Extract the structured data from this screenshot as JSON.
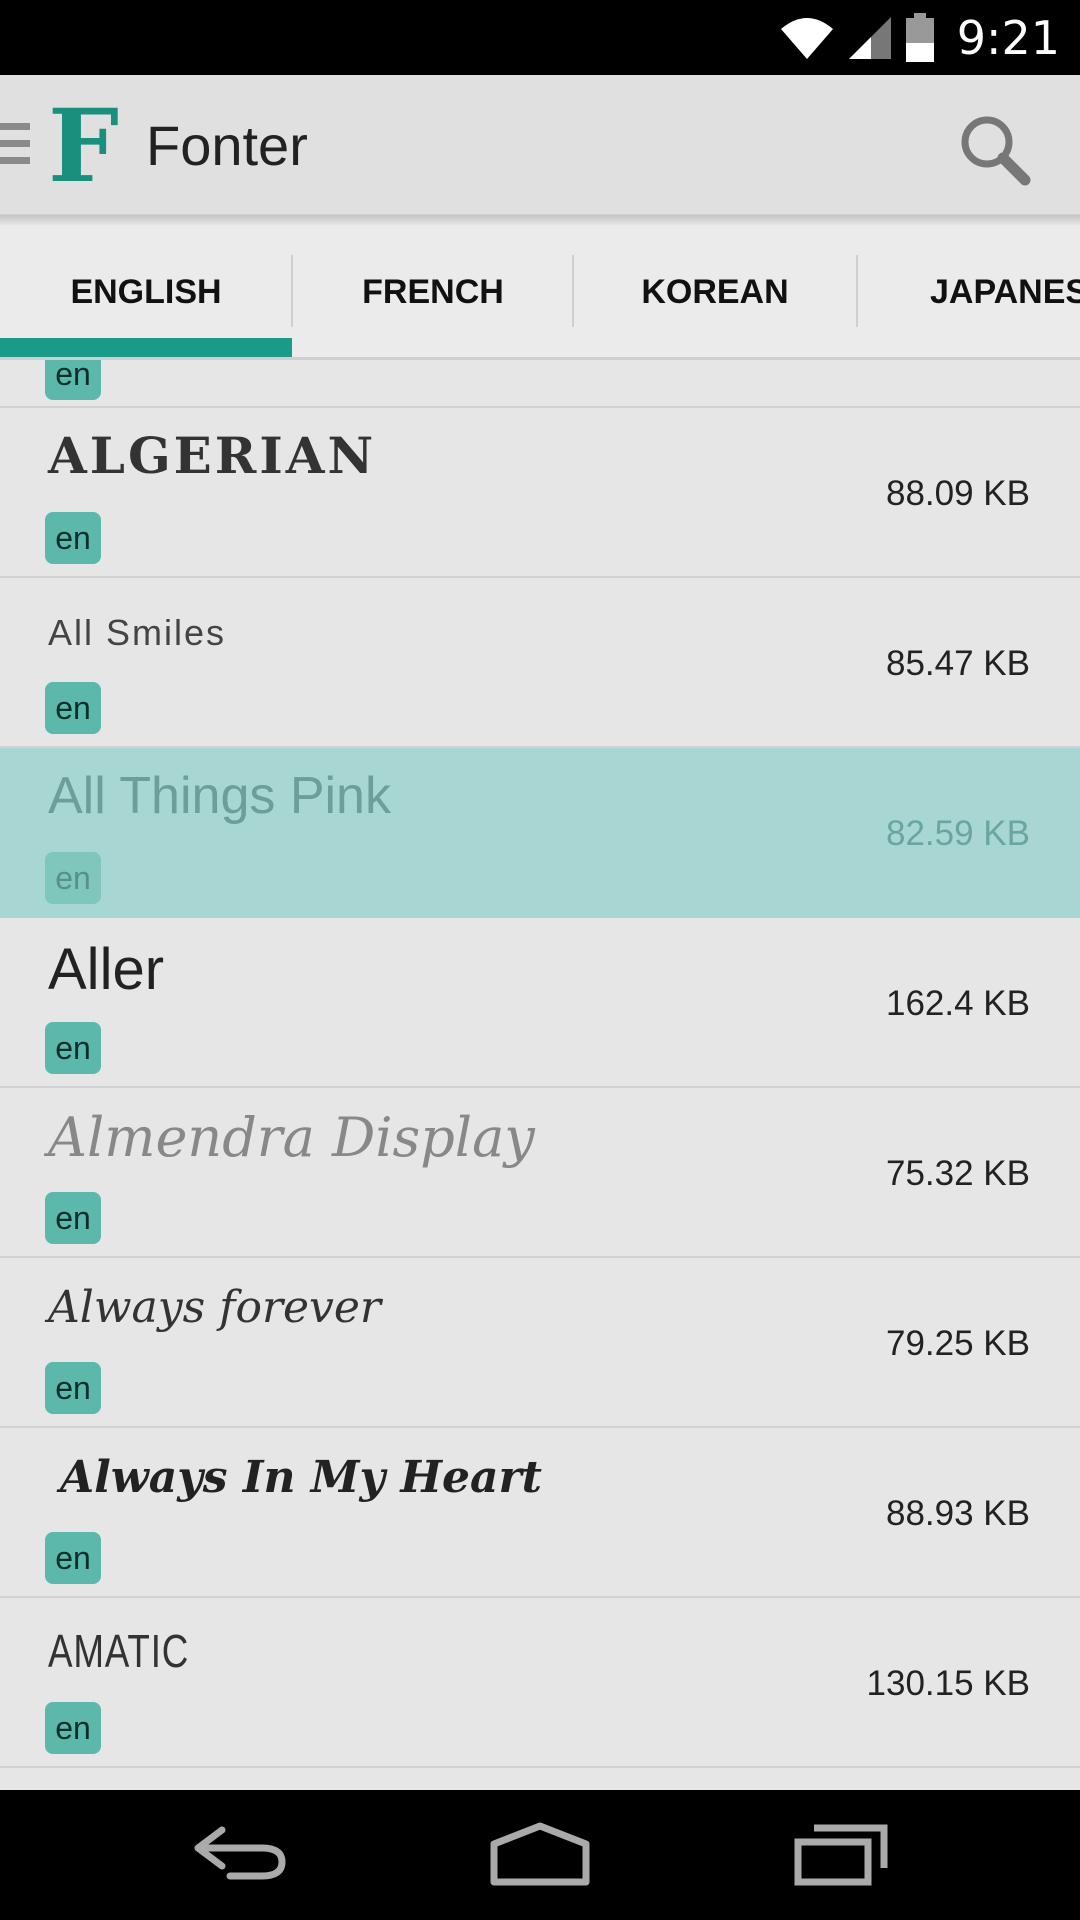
{
  "status_bar": {
    "time": "9:21"
  },
  "app_bar": {
    "title": "Fonter",
    "logo_letter": "F"
  },
  "tabs": [
    {
      "label": "ENGLISH",
      "selected": true
    },
    {
      "label": "FRENCH",
      "selected": false
    },
    {
      "label": "KOREAN",
      "selected": false
    },
    {
      "label": "JAPANESE",
      "selected": false
    }
  ],
  "partial_item": {
    "lang": "en"
  },
  "fonts": [
    {
      "name": "ALGERIAN",
      "size": "88.09 KB",
      "lang": "en",
      "selected": false
    },
    {
      "name": "All Smiles",
      "size": "85.47 KB",
      "lang": "en",
      "selected": false
    },
    {
      "name": "All Things Pink",
      "size": "82.59 KB",
      "lang": "en",
      "selected": true
    },
    {
      "name": "Aller",
      "size": "162.4 KB",
      "lang": "en",
      "selected": false
    },
    {
      "name": "Almendra Display",
      "size": "75.32 KB",
      "lang": "en",
      "selected": false
    },
    {
      "name": "Always forever",
      "size": "79.25 KB",
      "lang": "en",
      "selected": false
    },
    {
      "name": "Always In My Heart",
      "size": "88.93 KB",
      "lang": "en",
      "selected": false
    },
    {
      "name": "AMATIC",
      "size": "130.15 KB",
      "lang": "en",
      "selected": false
    }
  ],
  "colors": {
    "accent": "#1a9a88",
    "badge": "#5bb8aa",
    "selected_row": "#a8d6d2",
    "background": "#e6e6e6"
  }
}
